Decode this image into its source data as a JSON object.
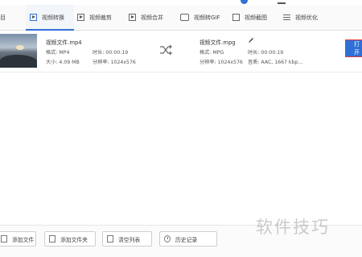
{
  "tabs": [
    {
      "label": "目",
      "active": false,
      "icon": null
    },
    {
      "label": "视频转换",
      "active": true,
      "icon": "play-icon"
    },
    {
      "label": "视频裁剪",
      "active": false,
      "icon": "crop-icon"
    },
    {
      "label": "视频合并",
      "active": false,
      "icon": "merge-icon"
    },
    {
      "label": "视频转GIF",
      "active": false,
      "icon": "gif-icon"
    },
    {
      "label": "视频截图",
      "active": false,
      "icon": "screenshot-icon"
    },
    {
      "label": "视频优化",
      "active": false,
      "icon": "equalizer-icon"
    }
  ],
  "source": {
    "name": "视频文件.mp4",
    "format": "格式: MP4",
    "duration": "时长: 00:00:19",
    "size": "大小: 4.09 MB",
    "resolution": "分辨率: 1024x576"
  },
  "output": {
    "name": "视频文件.mpg",
    "format": "格式: MPG",
    "duration": "时长: 00:00:19",
    "resolution": "分辨率: 1024x576",
    "audio": "音质: AAC, 1667 kbp..."
  },
  "actions": {
    "open_label": "打开"
  },
  "bottom_buttons": [
    {
      "label": "添加文件",
      "icon": "add-file-icon"
    },
    {
      "label": "添加文件夹",
      "icon": "folder-icon"
    },
    {
      "label": "清空列表",
      "icon": "trash-icon"
    },
    {
      "label": "历史记录",
      "icon": "clock-icon"
    }
  ],
  "watermark": "软件技巧",
  "colors": {
    "accent": "#2f6fd6",
    "highlight_border": "#e23b3b"
  }
}
